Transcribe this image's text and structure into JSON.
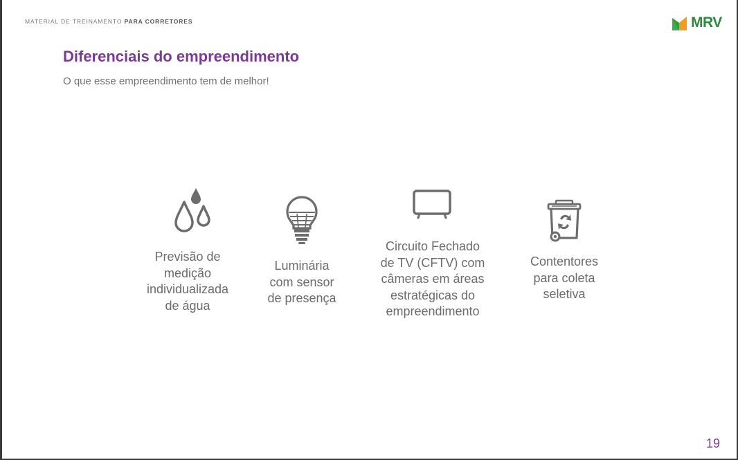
{
  "header": {
    "label_prefix": "MATERIAL DE TREINAMENTO ",
    "label_bold": "PARA CORRETORES"
  },
  "logo": {
    "text": "MRV",
    "colors": {
      "text": "#2c8a3c",
      "orange": "#f39a1f",
      "green": "#3fae49"
    }
  },
  "title": "Diferenciais do empreendimento",
  "subtitle": "O que esse empreendimento tem de melhor!",
  "features": [
    {
      "icon": "water-drops-icon",
      "label": "Previsão de\nmedição\nindividualizada\nde água"
    },
    {
      "icon": "light-bulb-icon",
      "label": "Luminária\ncom sensor\nde presença"
    },
    {
      "icon": "tv-monitor-icon",
      "label": "Circuito Fechado\nde TV (CFTV) com\ncâmeras em áreas\nestratégicas do\nempreendimento"
    },
    {
      "icon": "recycle-bin-icon",
      "label": "Contentores\npara coleta\nseletiva"
    }
  ],
  "page_number": "19",
  "colors": {
    "accent": "#7b3a92",
    "text": "#6b6b6b",
    "icon": "#6d6d6d"
  }
}
